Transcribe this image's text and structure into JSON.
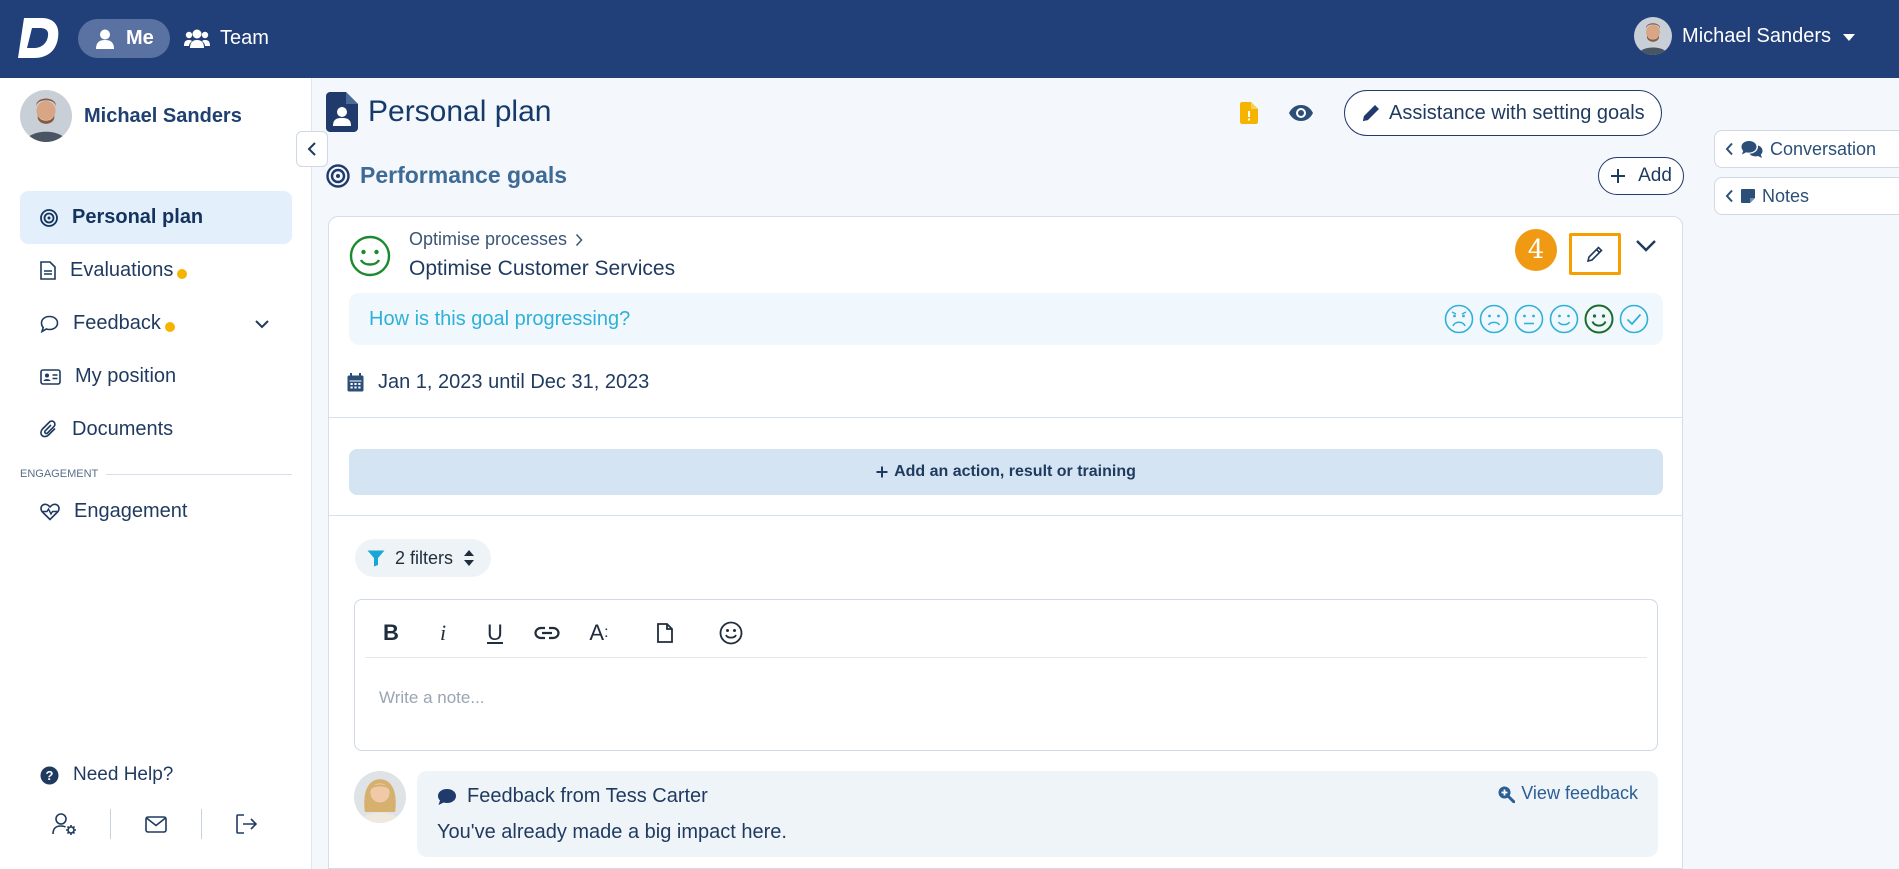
{
  "topbar": {
    "nav_me": "Me",
    "nav_team": "Team",
    "user_name": "Michael Sanders"
  },
  "sidebar": {
    "user_name": "Michael Sanders",
    "items": [
      {
        "label": "Personal plan",
        "icon": "target-icon",
        "active": true
      },
      {
        "label": "Evaluations",
        "icon": "document-icon",
        "badge": true
      },
      {
        "label": "Feedback",
        "icon": "chat-icon",
        "badge": true,
        "expandable": true
      },
      {
        "label": "My position",
        "icon": "id-card-icon"
      },
      {
        "label": "Documents",
        "icon": "paperclip-icon"
      }
    ],
    "section_label": "ENGAGEMENT",
    "engagement": {
      "label": "Engagement",
      "icon": "heart-pulse-icon"
    },
    "help_label": "Need Help?"
  },
  "main": {
    "page_title": "Personal plan",
    "assist_label": "Assistance with setting goals",
    "section_title": "Performance goals",
    "add_label": "Add",
    "goal": {
      "category": "Optimise processes",
      "title": "Optimise Customer Services",
      "step_badge": "4",
      "progress_question": "How is this goal progressing?",
      "moods": [
        "very-sad",
        "sad",
        "neutral",
        "happy",
        "very-happy",
        "done"
      ],
      "selected_mood": "very-happy",
      "date_range": "Jan 1, 2023 until Dec 31, 2023",
      "add_action_label": "Add an action, result or training",
      "filters_label": "2 filters",
      "editor_placeholder": "Write a note...",
      "feedback": {
        "title": "Feedback from Tess Carter",
        "view_label": "View feedback",
        "text": "You've already made a big impact here."
      }
    }
  },
  "right_panel": {
    "conversation_label": "Conversation",
    "notes_label": "Notes"
  },
  "colors": {
    "topbar": "#213f78",
    "accent_orange": "#f5a000",
    "badge_yellow": "#f5b400",
    "mood_blue": "#2eb0d9",
    "mood_green": "#1b8a2f"
  }
}
